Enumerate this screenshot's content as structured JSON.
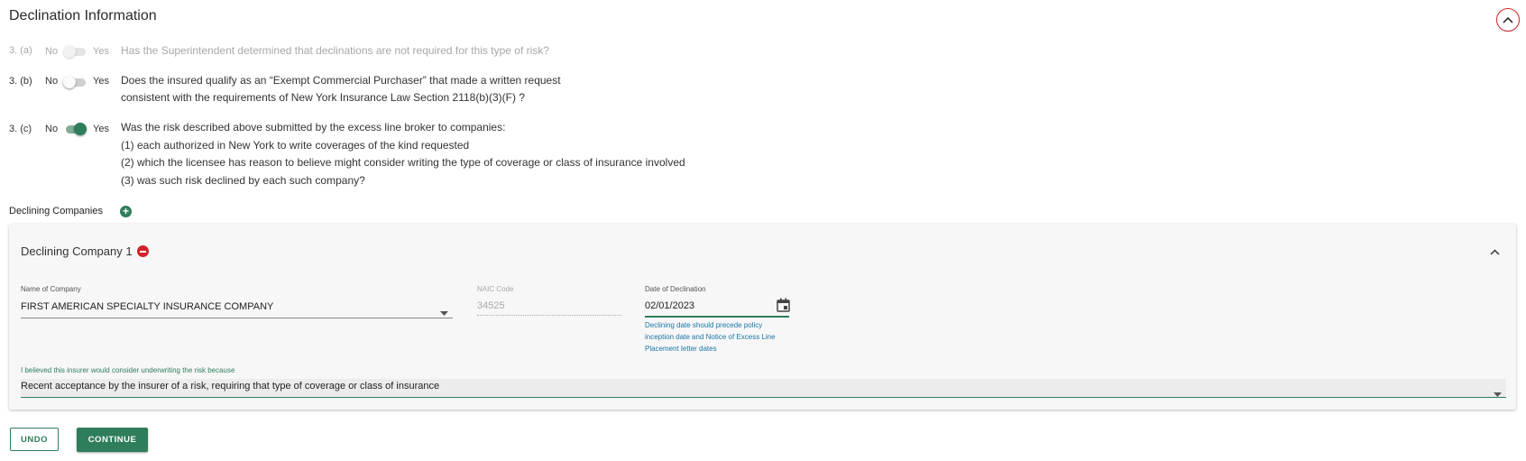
{
  "section": {
    "title": "Declination Information"
  },
  "questions": [
    {
      "number": "3. (a)",
      "no_label": "No",
      "yes_label": "Yes",
      "lines": [
        "Has the Superintendent determined that declinations are not required for this type of risk?"
      ],
      "value": "No",
      "disabled": true
    },
    {
      "number": "3. (b)",
      "no_label": "No",
      "yes_label": "Yes",
      "lines": [
        "Does the insured qualify as an “Exempt Commercial Purchaser” that made a written request",
        "consistent with the requirements of New York Insurance Law Section 2118(b)(3)(F) ?"
      ],
      "value": "No",
      "disabled": false
    },
    {
      "number": "3. (c)",
      "no_label": "No",
      "yes_label": "Yes",
      "lines": [
        "Was the risk described above submitted by the excess line broker to companies:",
        "(1) each authorized in New York to write coverages of the kind requested",
        "(2) which the licensee has reason to believe might consider writing the type of coverage or class of insurance involved",
        "(3) was such risk declined by each such company?"
      ],
      "value": "Yes",
      "disabled": false
    }
  ],
  "declining": {
    "label": "Declining Companies",
    "company": {
      "title": "Declining Company 1",
      "name_label": "Name of Company",
      "name_value": "FIRST AMERICAN SPECIALTY INSURANCE COMPANY",
      "naic_label": "NAIC Code",
      "naic_value": "34525",
      "date_label": "Date of Declination",
      "date_value": "02/01/2023",
      "date_help": [
        "Declining date should precede policy",
        "inception date and Notice of Excess Line",
        "Placement letter dates"
      ],
      "reason_label": "I believed this insurer would consider underwriting the risk because",
      "reason_value": "Recent acceptance by the insurer of a risk, requiring that type of coverage or class of insurance"
    }
  },
  "actions": {
    "undo": "UNDO",
    "continue": "CONTINUE"
  },
  "colors": {
    "accent": "#2e7d5b",
    "danger": "#d0232a",
    "help": "#1a76a8"
  }
}
